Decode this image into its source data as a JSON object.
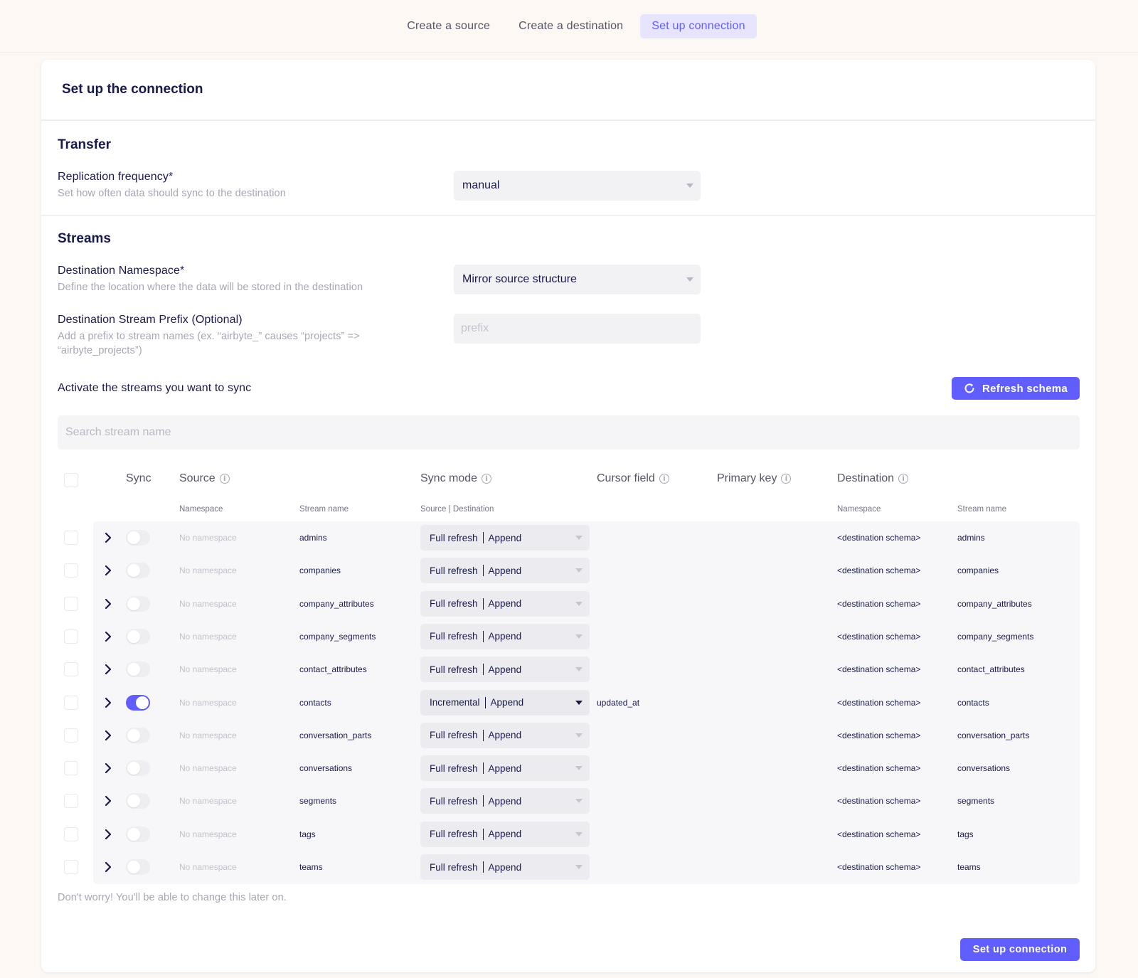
{
  "steps": [
    {
      "label": "Create a source"
    },
    {
      "label": "Create a destination"
    },
    {
      "label": "Set up connection"
    }
  ],
  "card_title": "Set up the connection",
  "transfer": {
    "title": "Transfer",
    "frequency_label": "Replication frequency*",
    "frequency_help": "Set how often data should sync to the destination",
    "frequency_value": "manual"
  },
  "streams": {
    "title": "Streams",
    "namespace_label": "Destination Namespace*",
    "namespace_help": "Define the location where the data will be stored in the destination",
    "namespace_value": "Mirror source structure",
    "prefix_label": "Destination Stream Prefix (Optional)",
    "prefix_help_1": "Add a prefix to stream names (ex. “airbyte_” causes “projects” =>",
    "prefix_help_2": "“airbyte_projects”)",
    "prefix_placeholder": "prefix",
    "activate_label": "Activate the streams you want to sync",
    "refresh_label": "Refresh schema",
    "search_placeholder": "Search stream name"
  },
  "table": {
    "headers": {
      "sync": "Sync",
      "source": "Source",
      "sync_mode": "Sync mode",
      "cursor_field": "Cursor field",
      "primary_key": "Primary key",
      "destination": "Destination"
    },
    "subheaders": {
      "namespace": "Namespace",
      "stream_name": "Stream name",
      "source_destination": "Source | Destination",
      "dest_namespace": "Namespace",
      "dest_stream_name": "Stream name"
    },
    "rows": [
      {
        "namespace": "No namespace",
        "stream": "admins",
        "mode_source": "Full refresh",
        "mode_dest": "Append",
        "cursor": "",
        "dest_namespace": "<destination schema>",
        "dest_stream": "admins",
        "sync": false
      },
      {
        "namespace": "No namespace",
        "stream": "companies",
        "mode_source": "Full refresh",
        "mode_dest": "Append",
        "cursor": "",
        "dest_namespace": "<destination schema>",
        "dest_stream": "companies",
        "sync": false
      },
      {
        "namespace": "No namespace",
        "stream": "company_attributes",
        "mode_source": "Full refresh",
        "mode_dest": "Append",
        "cursor": "",
        "dest_namespace": "<destination schema>",
        "dest_stream": "company_attributes",
        "sync": false
      },
      {
        "namespace": "No namespace",
        "stream": "company_segments",
        "mode_source": "Full refresh",
        "mode_dest": "Append",
        "cursor": "",
        "dest_namespace": "<destination schema>",
        "dest_stream": "company_segments",
        "sync": false
      },
      {
        "namespace": "No namespace",
        "stream": "contact_attributes",
        "mode_source": "Full refresh",
        "mode_dest": "Append",
        "cursor": "",
        "dest_namespace": "<destination schema>",
        "dest_stream": "contact_attributes",
        "sync": false
      },
      {
        "namespace": "No namespace",
        "stream": "contacts",
        "mode_source": "Incremental",
        "mode_dest": "Append",
        "cursor": "updated_at",
        "dest_namespace": "<destination schema>",
        "dest_stream": "contacts",
        "sync": true
      },
      {
        "namespace": "No namespace",
        "stream": "conversation_parts",
        "mode_source": "Full refresh",
        "mode_dest": "Append",
        "cursor": "",
        "dest_namespace": "<destination schema>",
        "dest_stream": "conversation_parts",
        "sync": false
      },
      {
        "namespace": "No namespace",
        "stream": "conversations",
        "mode_source": "Full refresh",
        "mode_dest": "Append",
        "cursor": "",
        "dest_namespace": "<destination schema>",
        "dest_stream": "conversations",
        "sync": false
      },
      {
        "namespace": "No namespace",
        "stream": "segments",
        "mode_source": "Full refresh",
        "mode_dest": "Append",
        "cursor": "",
        "dest_namespace": "<destination schema>",
        "dest_stream": "segments",
        "sync": false
      },
      {
        "namespace": "No namespace",
        "stream": "tags",
        "mode_source": "Full refresh",
        "mode_dest": "Append",
        "cursor": "",
        "dest_namespace": "<destination schema>",
        "dest_stream": "tags",
        "sync": false
      },
      {
        "namespace": "No namespace",
        "stream": "teams",
        "mode_source": "Full refresh",
        "mode_dest": "Append",
        "cursor": "",
        "dest_namespace": "<destination schema>",
        "dest_stream": "teams",
        "sync": false
      }
    ]
  },
  "note": "Don't worry! You'll be able to change this later on.",
  "submit_label": "Set up connection",
  "colors": {
    "accent": "#615eff",
    "accent_light": "#e6e4ff",
    "background": "#fdf8f3",
    "text": "#1a194d"
  }
}
